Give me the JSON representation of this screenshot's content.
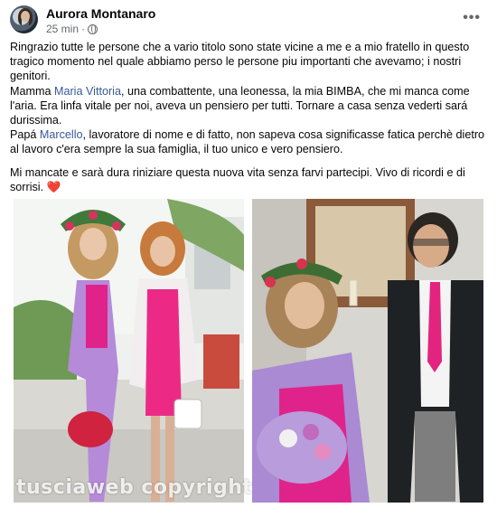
{
  "post": {
    "author": "Aurora Montanaro",
    "time": "25 min",
    "time_separator": "·",
    "more_icon": "more-horizontal-icon",
    "privacy_icon": "globe-icon",
    "paragraph1": "Ringrazio tutte le persone che a vario titolo sono state vicine a me e a mio fratello in questo tragico momento nel quale abbiamo perso le persone piu importanti che avevamo; i nostri genitori.",
    "mamma_prefix": "Mamma ",
    "mamma_mention": "Maria Vittoria",
    "mamma_rest": ", una combattente, una leonessa, la mia BIMBA, che mi manca come l'aria. Era linfa vitale per noi, aveva un pensiero per tutti. Tornare a casa senza vederti sará durissima.",
    "papa_prefix": "Papá ",
    "papa_mention": "Marcello",
    "papa_rest": ", lavoratore di nome e di fatto, non sapeva cosa significasse fatica perchè dietro al lavoro c'era sempre la sua famiglia, il tuo unico e vero pensiero.",
    "paragraph_last": "Mi mancate e sarà dura riniziare questa nuova vita senza farvi partecipi. Vivo di ricordi e di sorrisi.",
    "heart": "❤️"
  },
  "photos": {
    "watermark": "tusciaweb copyright"
  },
  "colors": {
    "text": "#050505",
    "secondary": "#65676b",
    "mention": "#385898",
    "heart": "#e41e3f"
  }
}
